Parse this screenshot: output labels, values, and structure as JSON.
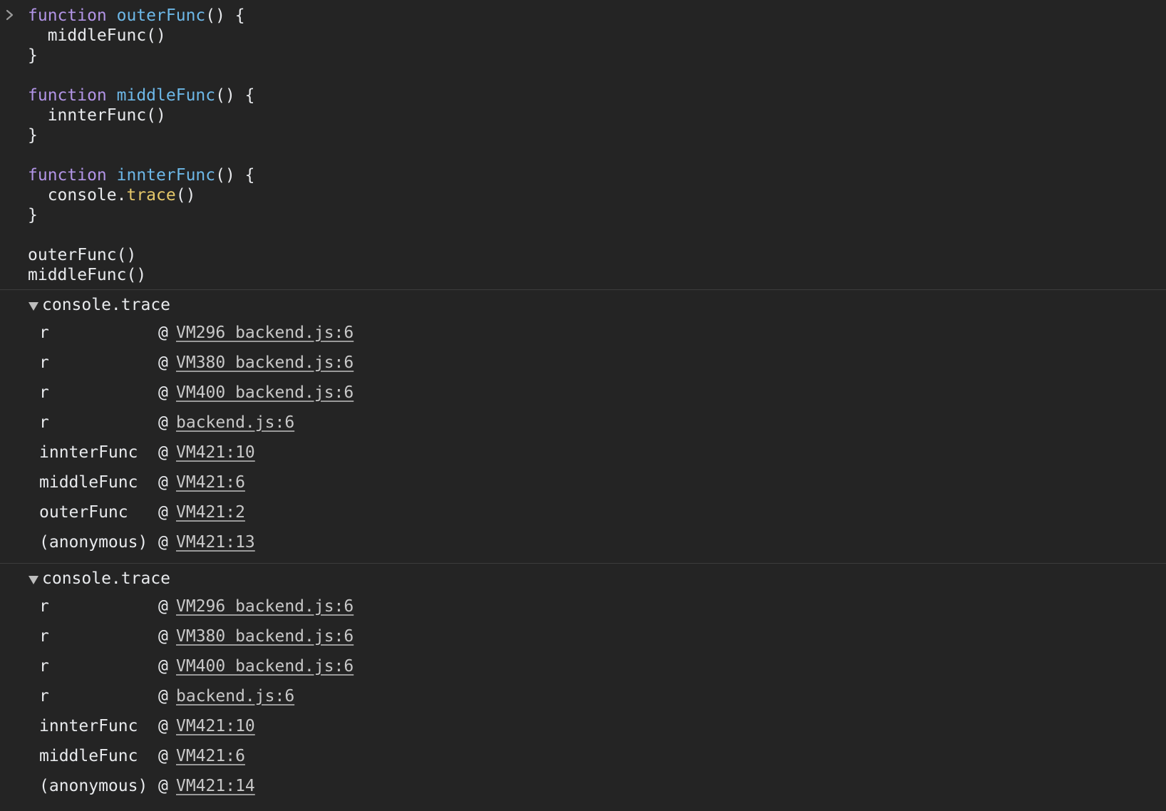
{
  "input": {
    "lines": [
      [
        {
          "t": "function",
          "c": "kw"
        },
        {
          "t": " ",
          "c": "pl"
        },
        {
          "t": "outerFunc",
          "c": "fn"
        },
        {
          "t": "() {",
          "c": "pl"
        }
      ],
      [
        {
          "t": "  middleFunc()",
          "c": "pl"
        }
      ],
      [
        {
          "t": "}",
          "c": "pl"
        }
      ],
      [
        {
          "t": "",
          "c": "pl"
        }
      ],
      [
        {
          "t": "function",
          "c": "kw"
        },
        {
          "t": " ",
          "c": "pl"
        },
        {
          "t": "middleFunc",
          "c": "fn"
        },
        {
          "t": "() {",
          "c": "pl"
        }
      ],
      [
        {
          "t": "  innterFunc()",
          "c": "pl"
        }
      ],
      [
        {
          "t": "}",
          "c": "pl"
        }
      ],
      [
        {
          "t": "",
          "c": "pl"
        }
      ],
      [
        {
          "t": "function",
          "c": "kw"
        },
        {
          "t": " ",
          "c": "pl"
        },
        {
          "t": "innterFunc",
          "c": "fn"
        },
        {
          "t": "() {",
          "c": "pl"
        }
      ],
      [
        {
          "t": "  console.",
          "c": "pl"
        },
        {
          "t": "trace",
          "c": "mt"
        },
        {
          "t": "()",
          "c": "pl"
        }
      ],
      [
        {
          "t": "}",
          "c": "pl"
        }
      ],
      [
        {
          "t": "",
          "c": "pl"
        }
      ],
      [
        {
          "t": "outerFunc()",
          "c": "pl"
        }
      ],
      [
        {
          "t": "middleFunc()",
          "c": "pl"
        }
      ]
    ]
  },
  "traces": [
    {
      "title": "console.trace",
      "frames": [
        {
          "fn": "r",
          "at": "@",
          "link": "VM296 backend.js:6"
        },
        {
          "fn": "r",
          "at": "@",
          "link": "VM380 backend.js:6"
        },
        {
          "fn": "r",
          "at": "@",
          "link": "VM400 backend.js:6"
        },
        {
          "fn": "r",
          "at": "@",
          "link": "backend.js:6"
        },
        {
          "fn": "innterFunc",
          "at": "@",
          "link": "VM421:10"
        },
        {
          "fn": "middleFunc",
          "at": "@",
          "link": "VM421:6"
        },
        {
          "fn": "outerFunc",
          "at": "@",
          "link": "VM421:2"
        },
        {
          "fn": "(anonymous)",
          "at": "@",
          "link": "VM421:13"
        }
      ]
    },
    {
      "title": "console.trace",
      "frames": [
        {
          "fn": "r",
          "at": "@",
          "link": "VM296 backend.js:6"
        },
        {
          "fn": "r",
          "at": "@",
          "link": "VM380 backend.js:6"
        },
        {
          "fn": "r",
          "at": "@",
          "link": "VM400 backend.js:6"
        },
        {
          "fn": "r",
          "at": "@",
          "link": "backend.js:6"
        },
        {
          "fn": "innterFunc",
          "at": "@",
          "link": "VM421:10"
        },
        {
          "fn": "middleFunc",
          "at": "@",
          "link": "VM421:6"
        },
        {
          "fn": "(anonymous)",
          "at": "@",
          "link": "VM421:14"
        }
      ]
    }
  ],
  "colors": {
    "background": "#242424",
    "keyword": "#b294e6",
    "function_name": "#6db8e8",
    "method": "#e5c86a",
    "text": "#e8eaed",
    "link": "#c8c8c8",
    "divider": "#3c3c3c"
  },
  "icons": {
    "prompt": "chevron-right-icon",
    "expand": "triangle-down-icon"
  }
}
